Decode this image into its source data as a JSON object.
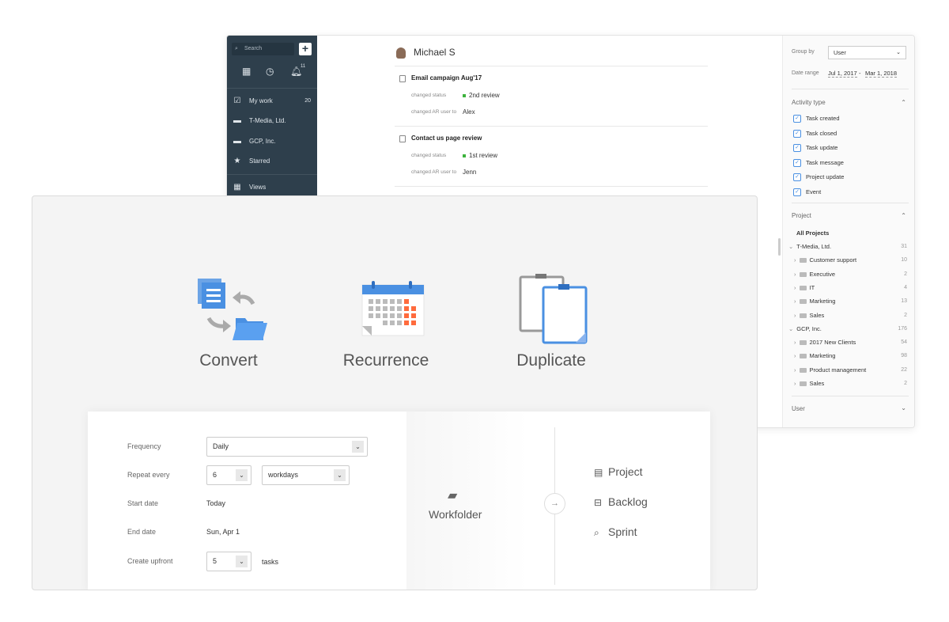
{
  "sidebar": {
    "search_placeholder": "Search",
    "add_label": "+",
    "notif_count": "11",
    "items": [
      {
        "label": "My work",
        "count": "20",
        "icon": "checkbox-icon"
      },
      {
        "label": "T-Media, Ltd.",
        "icon": "briefcase-icon"
      },
      {
        "label": "GCP, Inc.",
        "icon": "briefcase-icon"
      },
      {
        "label": "Starred",
        "icon": "star-icon"
      },
      {
        "label": "Views",
        "icon": "views-icon"
      }
    ]
  },
  "feed": {
    "user": "Michael S",
    "tasks": [
      {
        "title": "Email campaign Aug'17",
        "rows": [
          {
            "label": "changed status",
            "value": "2nd review",
            "status": true
          },
          {
            "label": "changed AR user to",
            "value": "Alex"
          }
        ]
      },
      {
        "title": "Contact us page review",
        "rows": [
          {
            "label": "changed status",
            "value": "1st review",
            "status": true
          },
          {
            "label": "changed AR user to",
            "value": "Jenn"
          }
        ]
      }
    ]
  },
  "filters": {
    "group_by_label": "Group by",
    "group_by_value": "User",
    "date_range_label": "Date range",
    "date_from": "Jul 1, 2017",
    "date_sep": "-",
    "date_to": "Mar 1, 2018",
    "activity_title": "Activity type",
    "activity": [
      "Task created",
      "Task closed",
      "Task update",
      "Task message",
      "Project update",
      "Event"
    ],
    "project_title": "Project",
    "all_projects": "All Projects",
    "tree": [
      {
        "name": "T-Media, Ltd.",
        "count": "31",
        "level": 0
      },
      {
        "name": "Customer support",
        "count": "10",
        "level": 1
      },
      {
        "name": "Executive",
        "count": "2",
        "level": 1
      },
      {
        "name": "IT",
        "count": "4",
        "level": 1
      },
      {
        "name": "Marketing",
        "count": "13",
        "level": 1
      },
      {
        "name": "Sales",
        "count": "2",
        "level": 1
      },
      {
        "name": "GCP, Inc.",
        "count": "176",
        "level": 0
      },
      {
        "name": "2017 New Clients",
        "count": "54",
        "level": 1
      },
      {
        "name": "Marketing",
        "count": "98",
        "level": 1
      },
      {
        "name": "Product management",
        "count": "22",
        "level": 1
      },
      {
        "name": "Sales",
        "count": "2",
        "level": 1
      }
    ],
    "user_title": "User"
  },
  "features": [
    "Convert",
    "Recurrence",
    "Duplicate"
  ],
  "recurrence": {
    "frequency_label": "Frequency",
    "frequency_value": "Daily",
    "repeat_label": "Repeat every",
    "repeat_value": "6",
    "repeat_unit": "workdays",
    "start_label": "Start date",
    "start_value": "Today",
    "end_label": "End date",
    "end_value": "Sun, Apr 1",
    "upfront_label": "Create upfront",
    "upfront_value": "5",
    "upfront_unit": "tasks"
  },
  "convert": {
    "source": "Workfolder",
    "targets": [
      "Project",
      "Backlog",
      "Sprint"
    ]
  },
  "colors": {
    "sidebar": "#2e3f4c",
    "accent": "#4a90e2",
    "status": "#3db33d",
    "calendar_highlight": "#ff6b3d"
  }
}
